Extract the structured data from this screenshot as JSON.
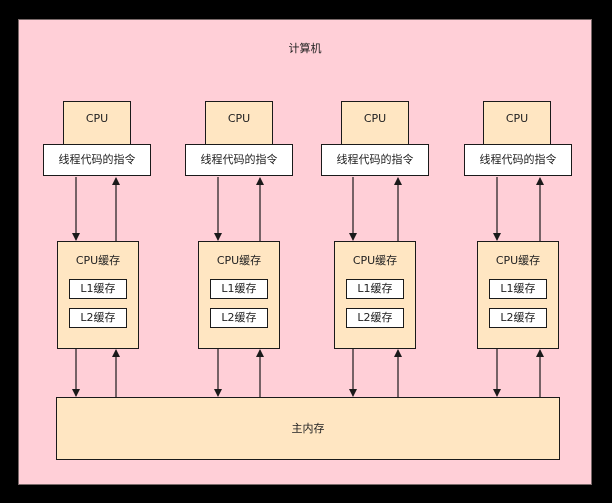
{
  "computer": {
    "title": "计算机"
  },
  "columns": [
    {
      "cpu_label": "CPU",
      "instruction_label": "线程代码的指令",
      "cache_label": "CPU缓存",
      "l1_label": "L1缓存",
      "l2_label": "L2缓存"
    },
    {
      "cpu_label": "CPU",
      "instruction_label": "线程代码的指令",
      "cache_label": "CPU缓存",
      "l1_label": "L1缓存",
      "l2_label": "L2缓存"
    },
    {
      "cpu_label": "CPU",
      "instruction_label": "线程代码的指令",
      "cache_label": "CPU缓存",
      "l1_label": "L1缓存",
      "l2_label": "L2缓存"
    },
    {
      "cpu_label": "CPU",
      "instruction_label": "线程代码的指令",
      "cache_label": "CPU缓存",
      "l1_label": "L1缓存",
      "l2_label": "L2缓存"
    }
  ],
  "main_memory": {
    "label": "主内存"
  },
  "colors": {
    "computer_fill": "#ffcfd7",
    "box_fill": "#ffe6c2",
    "instruction_fill": "#ffffff",
    "stroke": "#1a1a1a"
  }
}
